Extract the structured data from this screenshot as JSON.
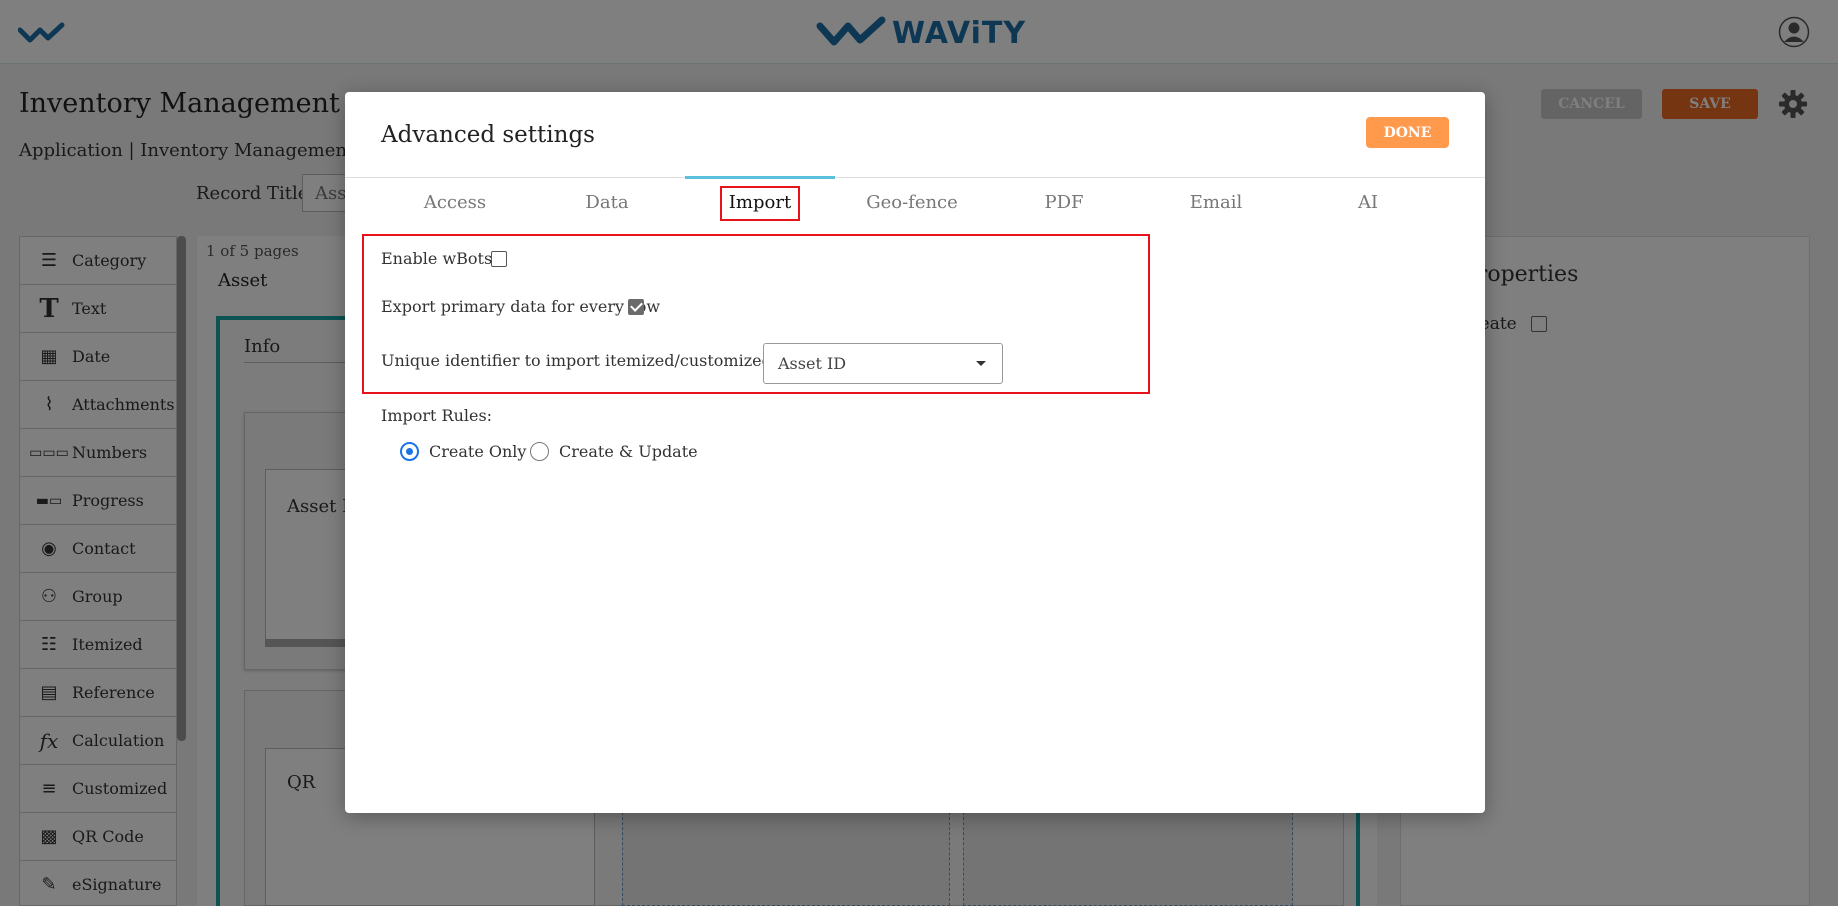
{
  "header": {
    "brand": "WAViTY"
  },
  "app": {
    "title": "Inventory Management",
    "breadcrumb": "Application | Inventory Management Table",
    "record_title_label": "Record Title",
    "record_title_value": "Asset",
    "cancel_label": "CANCEL",
    "save_label": "SAVE"
  },
  "palette": {
    "items": [
      {
        "label": "Category",
        "icon": "list-icon"
      },
      {
        "label": "Text",
        "icon": "text-icon"
      },
      {
        "label": "Date",
        "icon": "calendar-icon"
      },
      {
        "label": "Attachments",
        "icon": "paperclip-icon"
      },
      {
        "label": "Numbers",
        "icon": "numbers-icon"
      },
      {
        "label": "Progress",
        "icon": "progress-icon"
      },
      {
        "label": "Contact",
        "icon": "contact-icon"
      },
      {
        "label": "Group",
        "icon": "group-icon"
      },
      {
        "label": "Itemized",
        "icon": "itemized-icon"
      },
      {
        "label": "Reference",
        "icon": "document-icon"
      },
      {
        "label": "Calculation",
        "icon": "fx-icon"
      },
      {
        "label": "Customized",
        "icon": "lines-icon"
      },
      {
        "label": "QR Code",
        "icon": "qr-icon"
      },
      {
        "label": "eSignature",
        "icon": "pen-icon"
      }
    ]
  },
  "canvas": {
    "pages_info": "1 of 5 pages",
    "page_tab": "Asset",
    "section_title": "Info",
    "card1_label": "Asset ID",
    "card2_label": "QR"
  },
  "properties": {
    "title": "Properties",
    "create_label": "create"
  },
  "modal": {
    "title": "Advanced settings",
    "done_label": "DONE",
    "tabs": [
      "Access",
      "Data",
      "Import",
      "Geo-fence",
      "PDF",
      "Email",
      "AI"
    ],
    "active_tab": "Import",
    "enable_wbots_label": "Enable wBots",
    "enable_wbots_checked": false,
    "export_primary_label": "Export primary data for every row",
    "export_primary_checked": true,
    "unique_identifier_label": "Unique identifier to import itemized/customized data",
    "unique_identifier_value": "Asset ID",
    "import_rules_label": "Import Rules:",
    "rules": [
      {
        "label": "Create Only",
        "selected": true
      },
      {
        "label": "Create & Update",
        "selected": false
      }
    ]
  },
  "colors": {
    "brand_blue": "#1b6fa6",
    "done_orange": "#ff9a4d",
    "save_orange": "#e86a20",
    "highlight_red": "#e8131a",
    "tab_indicator": "#5bc0de",
    "radio_blue": "#1a73e8"
  }
}
